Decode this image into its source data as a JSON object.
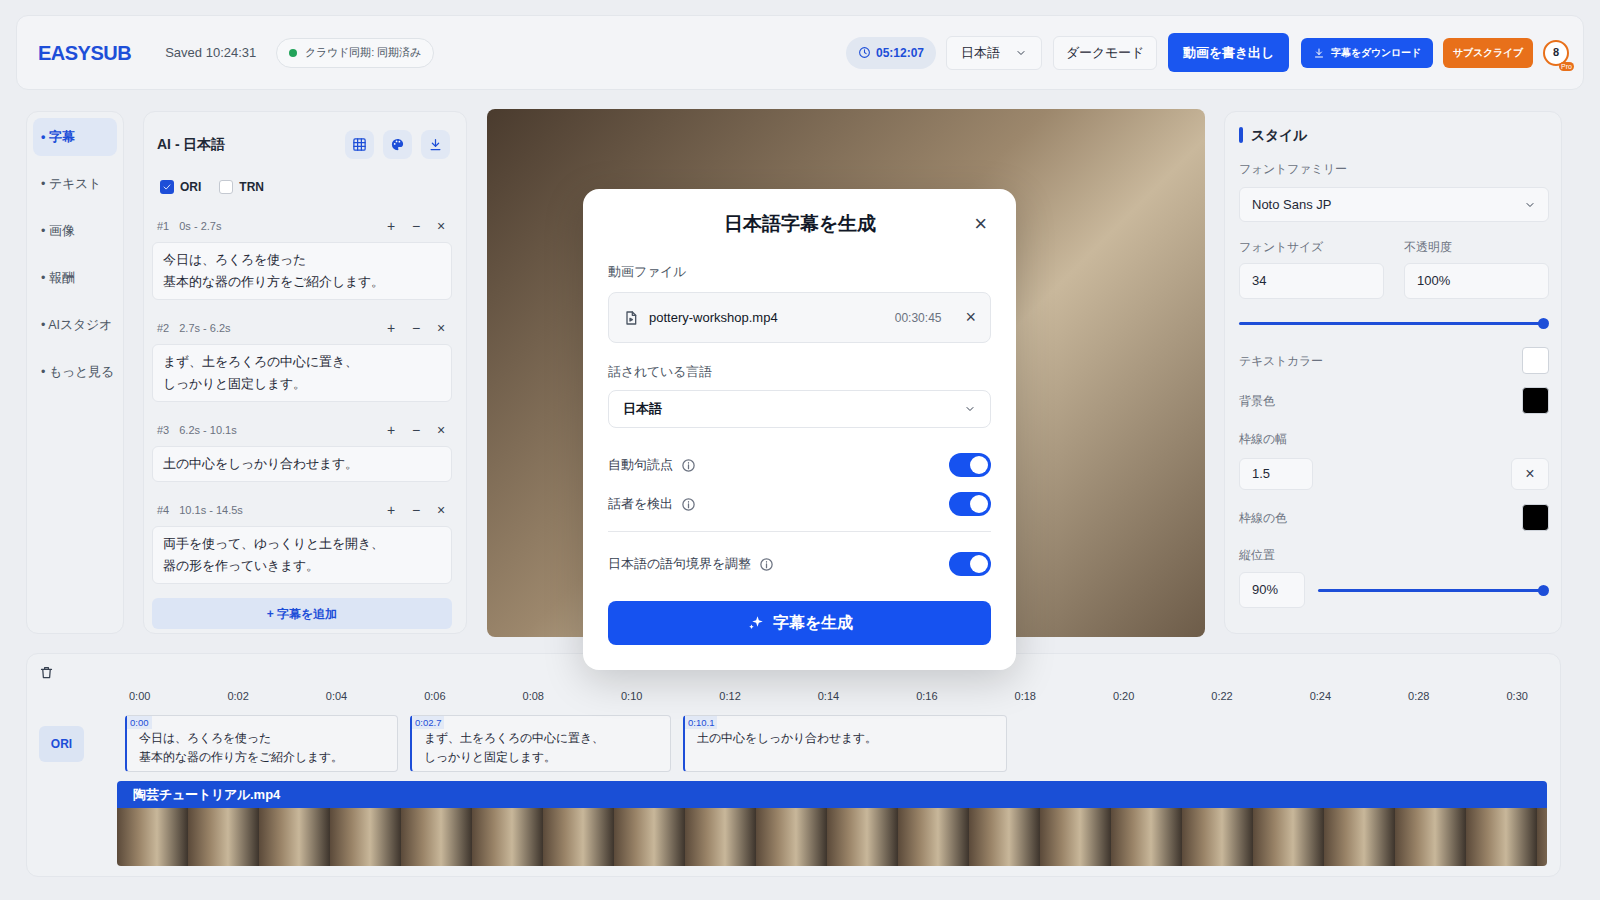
{
  "topbar": {
    "logo": "EASYSUB",
    "saved": "Saved 10:24:31",
    "sync": {
      "label": "クラウド同期: 同期済み",
      "synced": true
    },
    "timer": "05:12:07",
    "language": "日本語",
    "dark_mode": "ダークモード",
    "export": "動画を書き出し",
    "download": "字幕をダウンロード",
    "subscribe": "サブスクライブ",
    "avatar": {
      "count": "8",
      "badge": "Pro"
    }
  },
  "nav": [
    {
      "label": "• 字幕",
      "selected": true
    },
    {
      "label": "• テキスト",
      "selected": false
    },
    {
      "label": "• 画像",
      "selected": false
    },
    {
      "label": "• 報酬",
      "selected": false
    },
    {
      "label": "• AIスタジオ",
      "selected": false
    },
    {
      "label": "• もっと見る",
      "selected": false
    }
  ],
  "subtitles": {
    "title": "AI - 日本語",
    "tracks": [
      {
        "label": "ORI",
        "checked": true
      },
      {
        "label": "TRN",
        "checked": false
      }
    ],
    "entry_actions": [
      "+",
      "−",
      "×"
    ],
    "entries": [
      {
        "id": "#1",
        "time": "0s - 2.7s",
        "text": "今日は、ろくろを使った\n基本的な器の作り方をご紹介します。"
      },
      {
        "id": "#2",
        "time": "2.7s - 6.2s",
        "text": "まず、土をろくろの中心に置き、\nしっかりと固定します。"
      },
      {
        "id": "#3",
        "time": "6.2s - 10.1s",
        "text": "土の中心をしっかり合わせます。"
      },
      {
        "id": "#4",
        "time": "10.1s - 14.5s",
        "text": "両手を使って、ゆっくりと土を開き、\n器の形を作っていきます。"
      }
    ],
    "add": "+ 字幕を追加"
  },
  "modal": {
    "title": "日本語字幕を生成",
    "close": "×",
    "file_label": "動画ファイル",
    "file": {
      "name": "pottery-workshop.mp4",
      "duration": "00:30:45",
      "remove": "×"
    },
    "language_label": "話されている言語",
    "language": "日本語",
    "options": [
      {
        "label": "自動句読点",
        "on": true
      },
      {
        "label": "話者を検出",
        "on": true
      },
      {
        "label": "日本語の語句境界を調整",
        "on": true
      }
    ],
    "submit": "字幕を生成"
  },
  "style": {
    "title": "スタイル",
    "font_family": {
      "label": "フォントファミリー",
      "value": "Noto Sans JP"
    },
    "font_size": {
      "label": "フォントサイズ",
      "value": "34"
    },
    "opacity": {
      "label": "不透明度",
      "value": "100%",
      "level": 1
    },
    "text_color": {
      "label": "テキストカラー",
      "color": "#ffffff"
    },
    "bg_color": {
      "label": "背景色",
      "color": "#000000"
    },
    "border_width": {
      "label": "枠線の幅",
      "value": "1.5",
      "clear": "×"
    },
    "border_color": {
      "label": "枠線の色",
      "color": "#000000"
    },
    "position": {
      "label": "縦位置",
      "value": "90%",
      "level": 1
    }
  },
  "timeline": {
    "ticks": [
      "0:00",
      "0:02",
      "0:04",
      "0:06",
      "0:08",
      "0:10",
      "0:12",
      "0:14",
      "0:16",
      "0:18",
      "0:20",
      "0:22",
      "0:24",
      "0:28",
      "0:30"
    ],
    "track_label": "ORI",
    "clips": [
      {
        "start": "0:00",
        "text": "今日は、ろくろを使った\n基本的な器の作り方をご紹介します。"
      },
      {
        "start": "0:02.7",
        "text": "まず、土をろくろの中心に置き、\nしっかりと固定します。"
      },
      {
        "start": "0:10.1",
        "text": "土の中心をしっかり合わせます。"
      }
    ],
    "video": {
      "name": "陶芸チュートリアル.mp4"
    }
  }
}
